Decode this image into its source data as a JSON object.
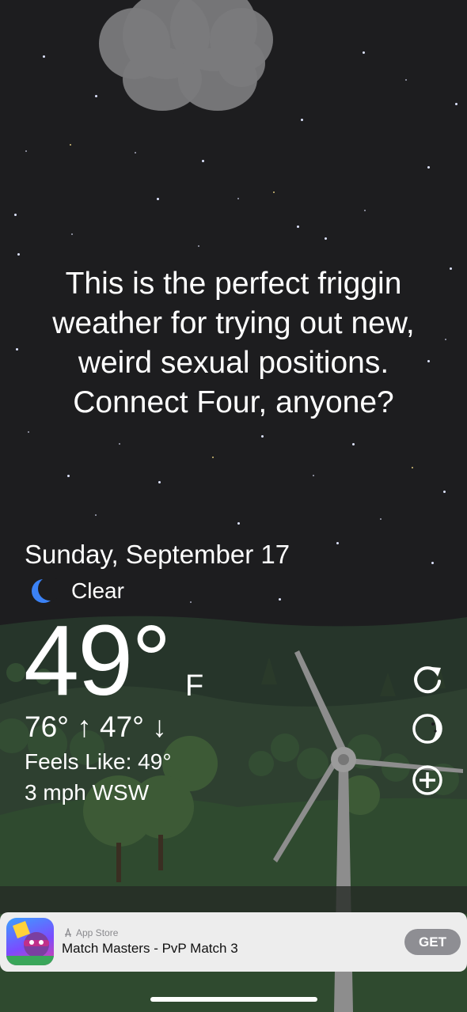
{
  "quote": {
    "lines": [
      "This is the perfect friggin",
      "weather for trying out new,",
      "weird sexual positions.",
      "Connect Four, anyone?"
    ]
  },
  "weather": {
    "date": "Sunday, September 17",
    "condition": "Clear",
    "condition_icon": "crescent-moon-icon",
    "temperature": "49°",
    "unit": "F",
    "high_low": "76° ↑  47° ↓",
    "feels_like": "Feels Like: 49°",
    "wind": "3 mph WSW"
  },
  "actions": [
    {
      "icon": "refresh-icon"
    },
    {
      "icon": "moon-phase-icon"
    },
    {
      "icon": "add-location-icon"
    }
  ],
  "ad": {
    "store_label": "App Store",
    "app_name": "Match Masters - PvP Match 3",
    "cta": "GET"
  },
  "colors": {
    "sky": "#1d1d1f",
    "hills": "#2c3a2c",
    "moon": "#3b82f6",
    "ad_button": "#8e8e93"
  }
}
